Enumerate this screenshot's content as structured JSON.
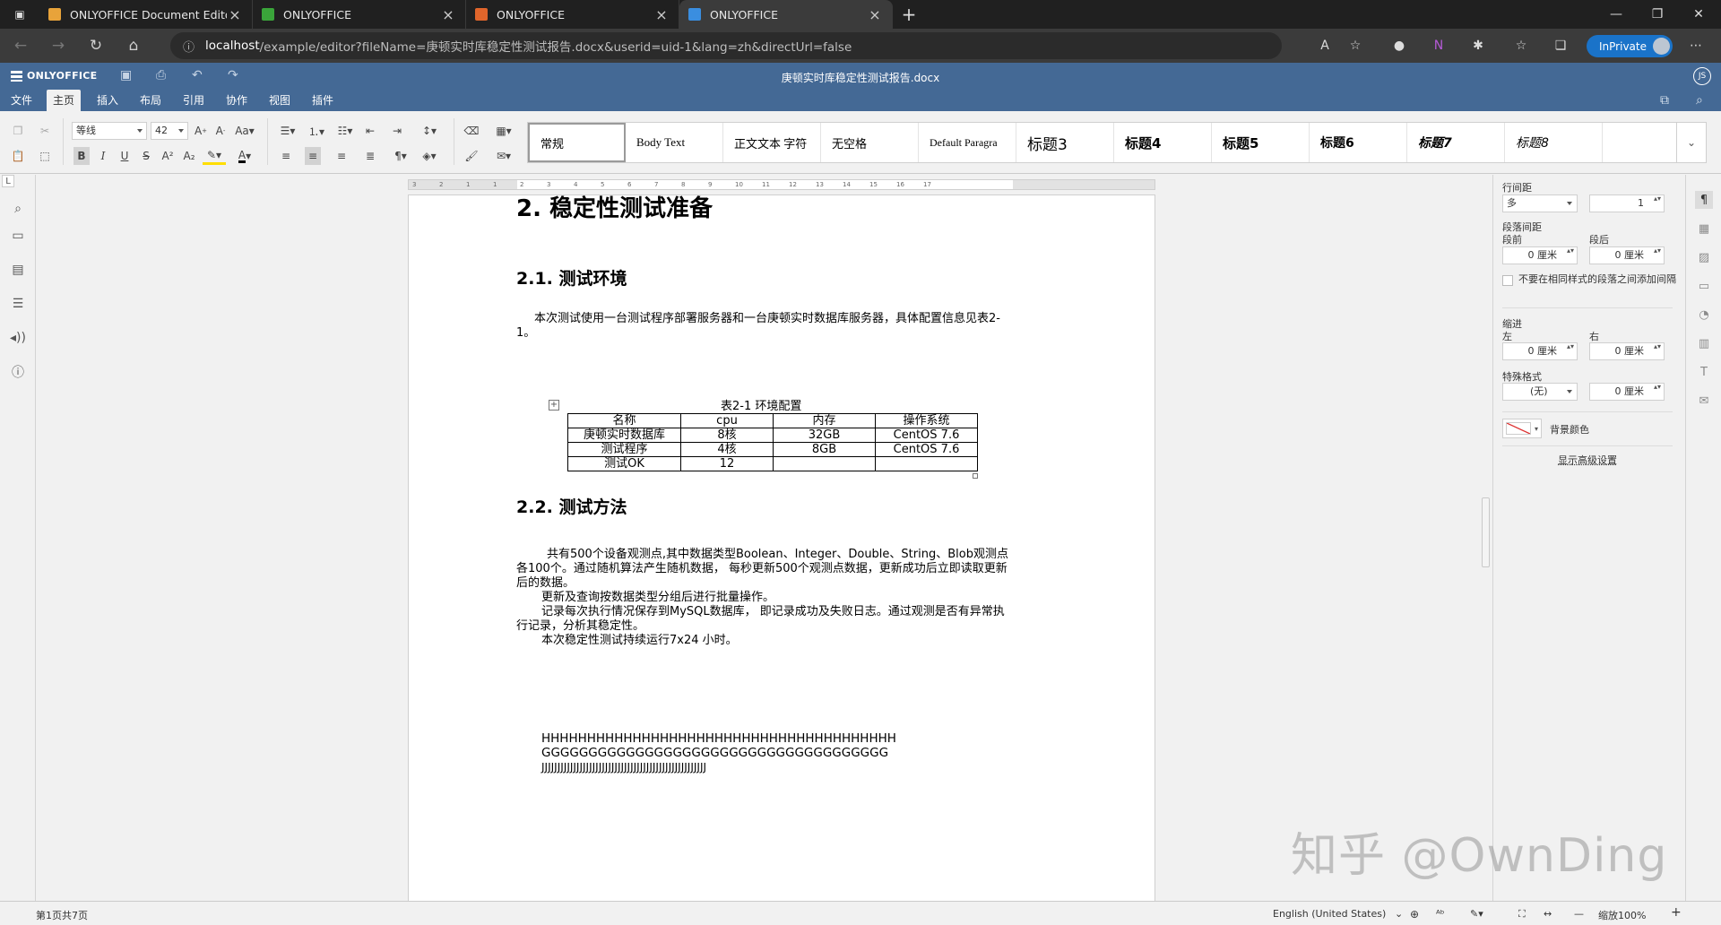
{
  "browser": {
    "tabs": [
      {
        "title": "ONLYOFFICE Document Editors",
        "color": "#e8a33a"
      },
      {
        "title": "ONLYOFFICE",
        "color": "#3aa53a"
      },
      {
        "title": "ONLYOFFICE",
        "color": "#e0652b"
      },
      {
        "title": "ONLYOFFICE",
        "color": "#3a8ee0"
      }
    ],
    "url_host": "localhost",
    "url_path": "/example/editor?fileName=庚顿实时库稳定性测试报告.docx&userid=uid-1&lang=zh&directUrl=false",
    "inprivate_label": "InPrivate"
  },
  "app": {
    "logo": "ONLYOFFICE",
    "doc_title": "庚顿实时库稳定性测试报告.docx",
    "user_initials": "JS",
    "menu_tabs": [
      "文件",
      "主页",
      "插入",
      "布局",
      "引用",
      "协作",
      "视图",
      "插件"
    ],
    "active_tab": "主页"
  },
  "toolbar": {
    "font_name": "等线",
    "font_size": "42",
    "styles": [
      "常规",
      "Body Text",
      "正文文本  字符",
      "无空格",
      "Default Paragra",
      "标题3",
      "标题4",
      "标题5",
      "标题6",
      "标题7",
      "标题8"
    ]
  },
  "document": {
    "h1": "2. 稳定性测试准备",
    "h2_env": "2.1. 测试环境",
    "env_para": "本次测试使用一台测试程序部署服务器和一台庚顿实时数据库服务器，具体配置信息见表2-1。",
    "table_caption": "表2-1  环境配置",
    "table_rows": [
      [
        "名称",
        "cpu",
        "内存",
        "操作系统"
      ],
      [
        "庚顿实时数据库",
        "8核",
        "32GB",
        "CentOS 7.6"
      ],
      [
        "测试程序",
        "4核",
        "8GB",
        "CentOS 7.6"
      ],
      [
        "测试OK",
        "12",
        "",
        ""
      ]
    ],
    "h2_method": "2.2. 测试方法",
    "method_p1": "共有500个设备观测点,其中数据类型Boolean、Integer、Double、String、Blob观测点各100个。通过随机算法产生随机数据，  每秒更新500个观测点数据，更新成功后立即读取更新后的数据。",
    "method_p2": "更新及查询按数据类型分组后进行批量操作。",
    "method_p3": "记录每次执行情况保存到MySQL数据库，  即记录成功及失败日志。通过观测是否有异常执行记录，分析其稳定性。",
    "method_p4": "本次稳定性测试持续运行7x24  小时。",
    "line_h": "HHHHHHHHHHHHHHHHHHHHHHHHHHHHHHHHHHHHHHH",
    "line_g": "GGGGGGGGGGGGGGGGGGGGGGGGGGGGGGGGGGGGG",
    "line_j": "JJJJJJJJJJJJJJJJJJJJJJJJJJJJJJJJJJJJJJJJJJJJJJJJJJJJ"
  },
  "ruler_ticks": [
    "3",
    "2",
    "1",
    "1",
    "2",
    "3",
    "4",
    "5",
    "6",
    "7",
    "8",
    "9",
    "10",
    "11",
    "12",
    "13",
    "14",
    "15",
    "16",
    "17"
  ],
  "panel": {
    "line_spacing_label": "行间距",
    "line_spacing_mode": "多",
    "line_spacing_value": "1",
    "para_spacing_label": "段落间距",
    "before_label": "段前",
    "after_label": "段后",
    "before_value": "0 厘米",
    "after_value": "0 厘米",
    "no_space_label": "不要在相同样式的段落之间添加间隔",
    "indent_label": "缩进",
    "left_label": "左",
    "right_label": "右",
    "indent_left": "0 厘米",
    "indent_right": "0 厘米",
    "special_label": "特殊格式",
    "special_value": "(无)",
    "special_amount": "0 厘米",
    "bg_color_label": "背景颜色",
    "advanced_link": "显示高级设置"
  },
  "status": {
    "page_info": "第1页共7页",
    "language": "English (United States)",
    "zoom": "缩放100%"
  },
  "watermark": "知乎 @OwnDing"
}
